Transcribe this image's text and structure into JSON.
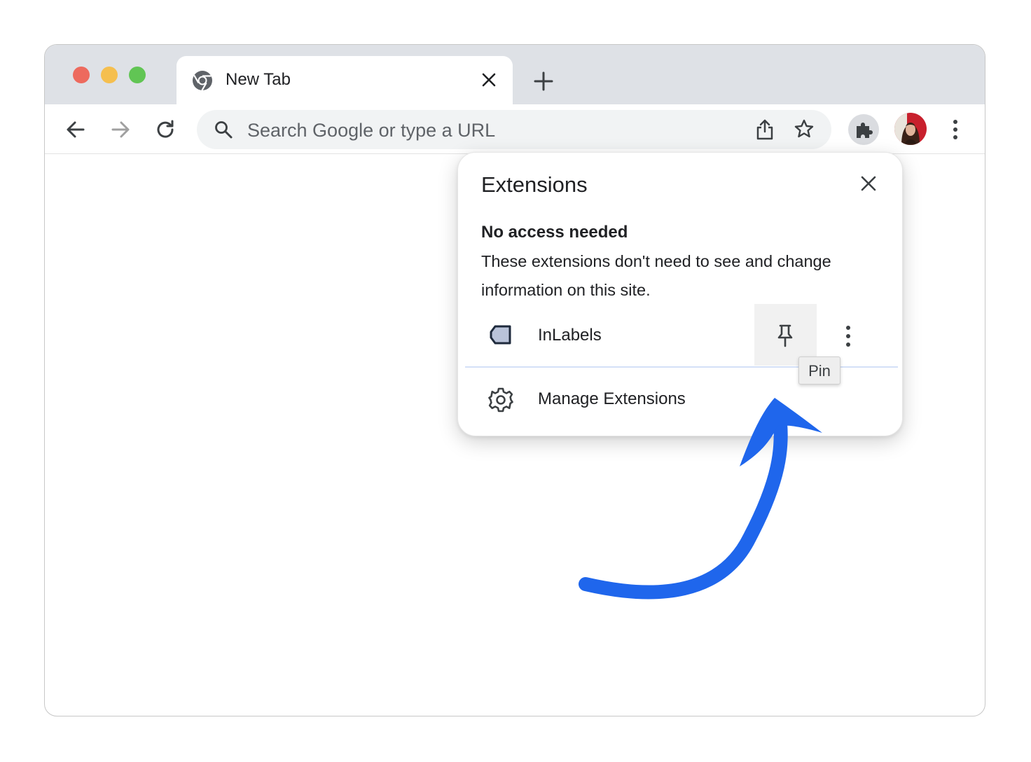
{
  "tab": {
    "title": "New Tab"
  },
  "omnibox": {
    "placeholder": "Search Google or type a URL"
  },
  "popup": {
    "title": "Extensions",
    "section_heading": "No access needed",
    "section_description": "These extensions don't need to see and change information on this site.",
    "extension": {
      "name": "InLabels",
      "icon": "tag-icon"
    },
    "manage_label": "Manage Extensions"
  },
  "tooltip": {
    "text": "Pin"
  },
  "colors": {
    "accent_arrow": "#1f66ec",
    "tab_strip": "#dee1e6",
    "omnibox_bg": "#f1f3f4",
    "traffic_red": "#ed6a5e",
    "traffic_yellow": "#f5bf4f",
    "traffic_green": "#61c554"
  },
  "icons": [
    "chrome-icon",
    "close-icon",
    "plus-icon",
    "back-arrow-icon",
    "forward-arrow-icon",
    "reload-icon",
    "search-icon",
    "share-icon",
    "star-icon",
    "puzzle-icon",
    "avatar",
    "kebab-menu-icon",
    "pin-icon",
    "gear-icon",
    "curved-arrow-annotation"
  ]
}
